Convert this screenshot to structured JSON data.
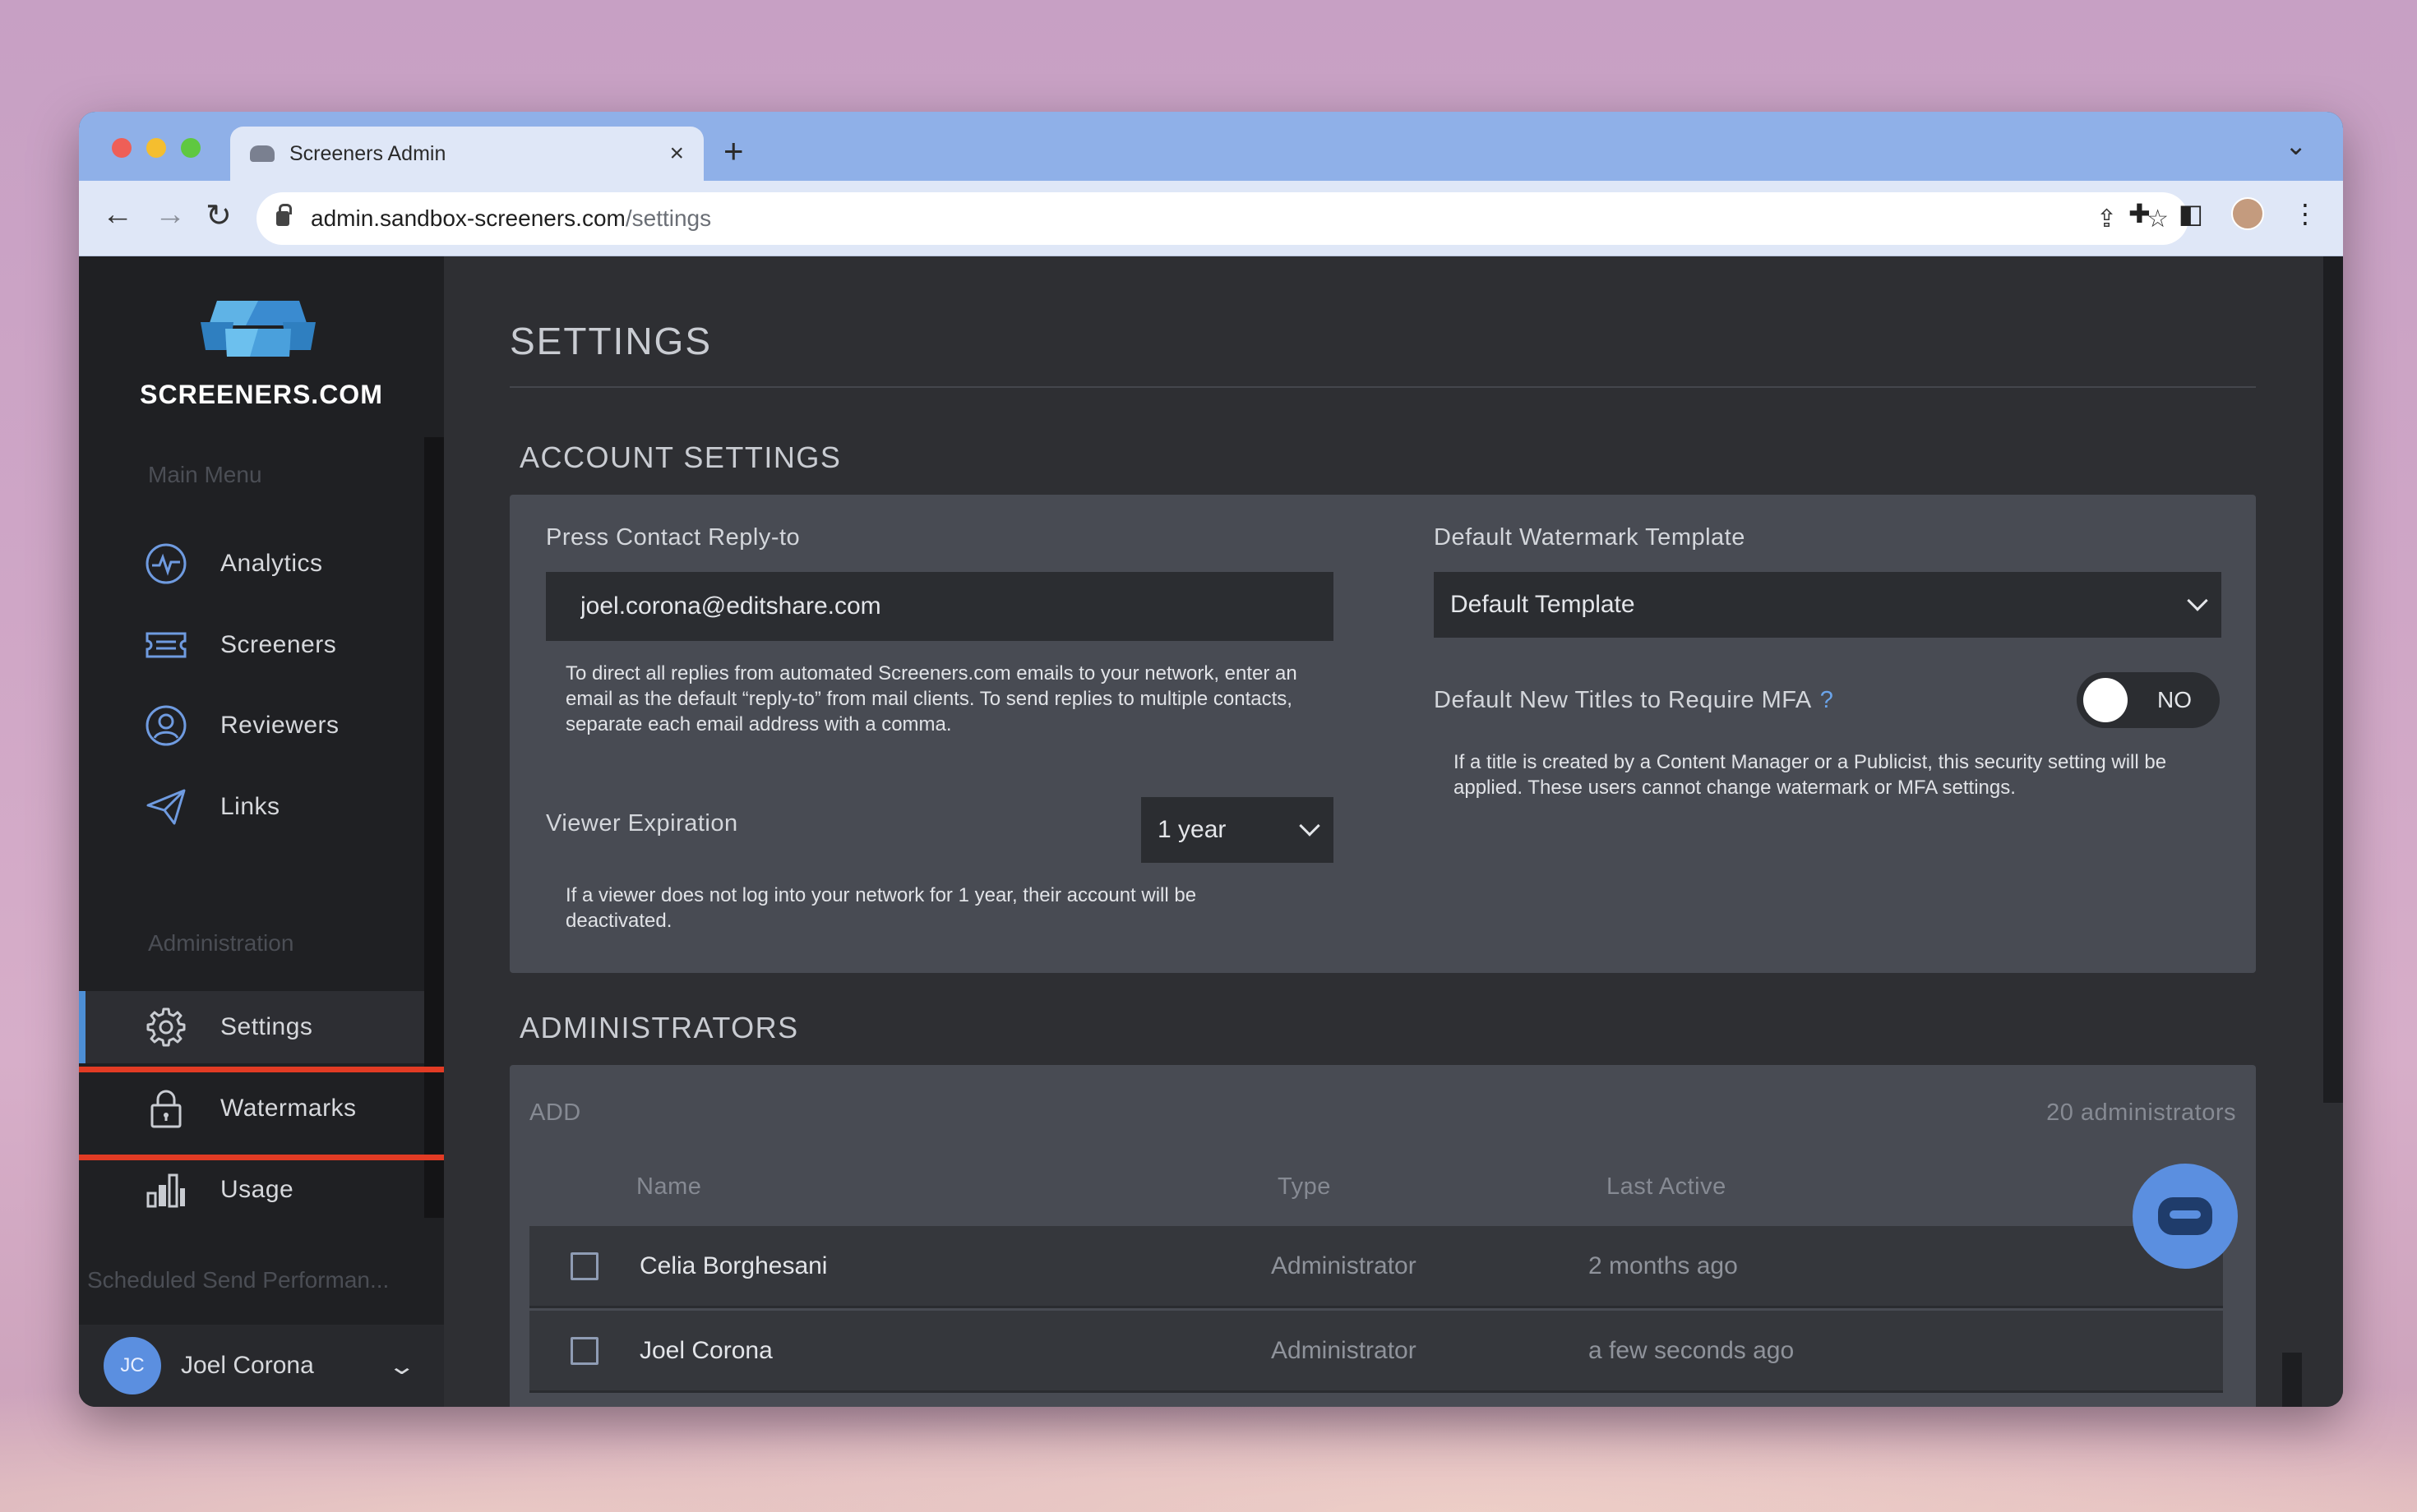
{
  "browser": {
    "tab_title": "Screeners Admin",
    "tab_close": "×",
    "new_tab": "+",
    "tab_menu": "⌄",
    "url_host": "admin.sandbox-screeners.com",
    "url_path": "/settings"
  },
  "sidebar": {
    "logo_text": "SCREENERS.COM",
    "main_menu_label": "Main Menu",
    "main_items": [
      {
        "label": "Analytics",
        "icon": "analytics-icon"
      },
      {
        "label": "Screeners",
        "icon": "ticket-icon"
      },
      {
        "label": "Reviewers",
        "icon": "user-circle-icon"
      },
      {
        "label": "Links",
        "icon": "paper-plane-icon"
      }
    ],
    "admin_label": "Administration",
    "admin_items": [
      {
        "label": "Settings",
        "icon": "gear-icon",
        "active": true
      },
      {
        "label": "Watermarks",
        "icon": "lock-icon"
      },
      {
        "label": "Usage",
        "icon": "bar-chart-icon"
      }
    ],
    "faded_item": "Scheduled Send Performan...",
    "user": {
      "initials": "JC",
      "name": "Joel Corona"
    }
  },
  "main": {
    "page_title": "SETTINGS",
    "account": {
      "title": "ACCOUNT SETTINGS",
      "press_contact_label": "Press Contact Reply-to",
      "press_contact_value": "joel.corona@editshare.com",
      "press_contact_help": "To direct all replies from automated Screeners.com emails to your network, enter an email as the default “reply-to” from mail clients. To send replies to multiple contacts, separate each email address with a comma.",
      "viewer_expiration_label": "Viewer Expiration",
      "viewer_expiration_value": "1 year",
      "viewer_expiration_help": "If a viewer does not log into your network for 1 year, their account will be deactivated.",
      "watermark_label": "Default Watermark Template",
      "watermark_value": "Default Template",
      "mfa_label": "Default New Titles to Require MFA",
      "mfa_help_mark": "?",
      "mfa_toggle": "NO",
      "mfa_help": "If a title is created by a Content Manager or a Publicist, this security setting will be applied. These users cannot change watermark or MFA settings."
    },
    "administrators": {
      "title": "ADMINISTRATORS",
      "add_label": "ADD",
      "count_label": "20 administrators",
      "columns": [
        "Name",
        "Type",
        "Last Active"
      ],
      "rows": [
        {
          "name": "Celia Borghesani",
          "type": "Administrator",
          "last_active": "2 months ago"
        },
        {
          "name": "Joel Corona",
          "type": "Administrator",
          "last_active": "a few seconds ago"
        }
      ]
    }
  },
  "colors": {
    "accent": "#4d8fd6",
    "highlight": "#e23b24",
    "chat": "#5b8fe0"
  }
}
